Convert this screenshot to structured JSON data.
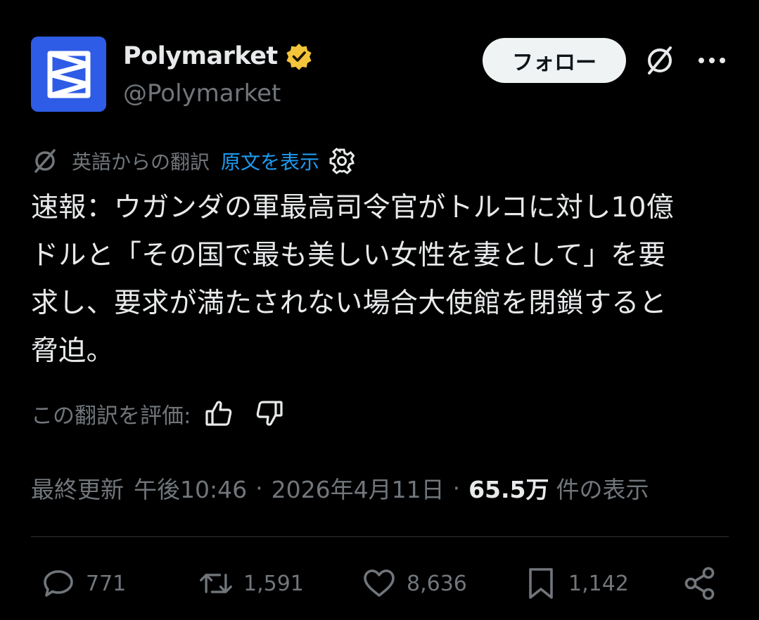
{
  "header": {
    "display_name": "Polymarket",
    "handle": "@Polymarket",
    "follow_label": "フォロー",
    "verified_color": "#f4c43b"
  },
  "translation": {
    "label": "英語からの翻訳",
    "show_original": "原文を表示"
  },
  "post": {
    "text": "速報：ウガンダの軍最高司令官がトルコに対し10億\nドルと「その国で最も美しい女性を妻として」を要\n求し、要求が満たされない場合大使館を閉鎖すると\n脅迫。"
  },
  "rate": {
    "label": "この翻訳を評価:"
  },
  "meta": {
    "updated_label": "最終更新",
    "time": "午後10:46",
    "separator": "·",
    "date": "2026年4月11日",
    "views_count": "65.5万",
    "views_label": "件の表示"
  },
  "actions": {
    "replies": "771",
    "reposts": "1,591",
    "likes": "8,636",
    "bookmarks": "1,142"
  },
  "colors": {
    "accent": "#1d9bf0",
    "avatar_bg": "#2e5ce6",
    "muted": "#71767b",
    "text": "#e7e9ea"
  },
  "icons": [
    "polymarket-logo-icon",
    "verified-badge-icon",
    "grok-icon",
    "more-icon",
    "translate-icon",
    "gear-icon",
    "thumbs-up-icon",
    "thumbs-down-icon",
    "reply-icon",
    "repost-icon",
    "like-icon",
    "bookmark-icon",
    "share-icon"
  ]
}
